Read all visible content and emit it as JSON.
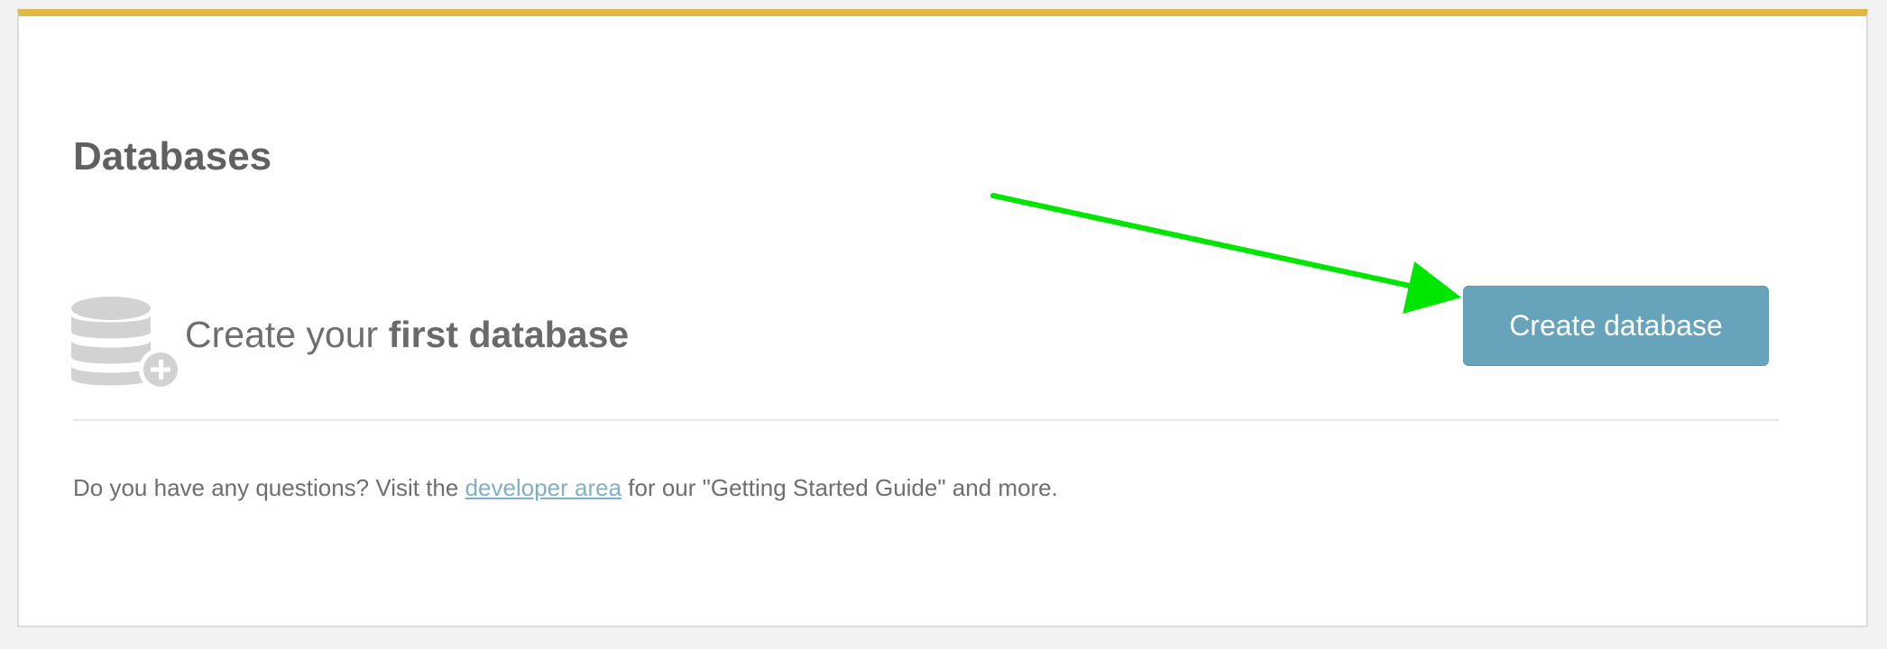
{
  "header": {
    "title": "Databases"
  },
  "empty_state": {
    "prefix": "Create your ",
    "emphasis": "first database",
    "icon": "database-add-icon"
  },
  "actions": {
    "create_label": "Create database"
  },
  "help": {
    "before": "Do you have any questions? Visit the ",
    "link_label": "developer area",
    "after": " for our \"Getting Started Guide\" and more."
  },
  "colors": {
    "accent_bar": "#e0b84a",
    "button": "#67a3ba",
    "link": "#7fb0c4",
    "annotation_arrow": "#00e600"
  }
}
